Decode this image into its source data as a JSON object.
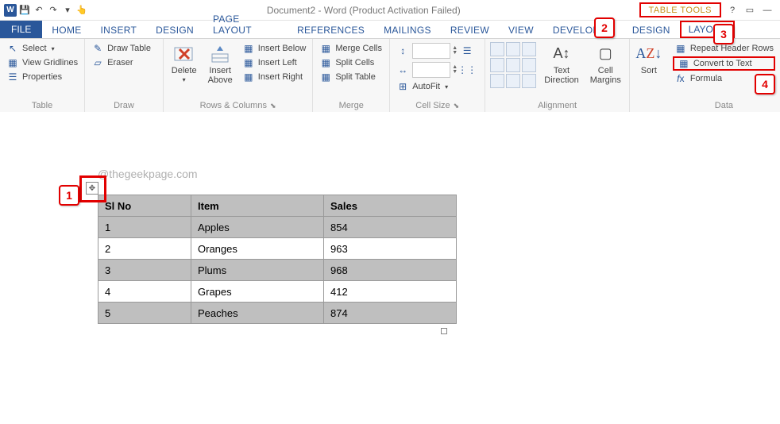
{
  "title": "Document2 - Word (Product Activation Failed)",
  "table_tools_label": "TABLE TOOLS",
  "tabs": {
    "file": "FILE",
    "home": "HOME",
    "insert": "INSERT",
    "design": "DESIGN",
    "page_layout": "PAGE LAYOUT",
    "references": "REFERENCES",
    "mailings": "MAILINGS",
    "review": "REVIEW",
    "view": "VIEW",
    "developer": "DEVELOPER",
    "tt_design": "DESIGN",
    "tt_layout": "LAYOUT"
  },
  "ribbon": {
    "table": {
      "label": "Table",
      "select": "Select",
      "gridlines": "View Gridlines",
      "properties": "Properties"
    },
    "draw": {
      "label": "Draw",
      "draw_table": "Draw Table",
      "eraser": "Eraser"
    },
    "rows_cols": {
      "label": "Rows & Columns",
      "delete": "Delete",
      "insert_above": "Insert\nAbove",
      "insert_below": "Insert Below",
      "insert_left": "Insert Left",
      "insert_right": "Insert Right"
    },
    "merge": {
      "label": "Merge",
      "merge_cells": "Merge Cells",
      "split_cells": "Split Cells",
      "split_table": "Split Table"
    },
    "cell_size": {
      "label": "Cell Size",
      "autofit": "AutoFit",
      "height": "",
      "width": ""
    },
    "alignment": {
      "label": "Alignment",
      "text_direction": "Text\nDirection",
      "cell_margins": "Cell\nMargins"
    },
    "sort_label": "Sort",
    "data": {
      "label": "Data",
      "repeat": "Repeat Header Rows",
      "convert": "Convert to Text",
      "formula": "Formula"
    }
  },
  "watermark": "@thegeekpage.com",
  "table": {
    "headers": [
      "Sl No",
      "Item",
      "Sales"
    ],
    "rows": [
      {
        "sl": "1",
        "item": "Apples",
        "sales": "854"
      },
      {
        "sl": "2",
        "item": "Oranges",
        "sales": "963"
      },
      {
        "sl": "3",
        "item": "Plums",
        "sales": "968"
      },
      {
        "sl": "4",
        "item": "Grapes",
        "sales": "412"
      },
      {
        "sl": "5",
        "item": "Peaches",
        "sales": "874"
      }
    ]
  },
  "callouts": {
    "c1": "1",
    "c2": "2",
    "c3": "3",
    "c4": "4"
  }
}
